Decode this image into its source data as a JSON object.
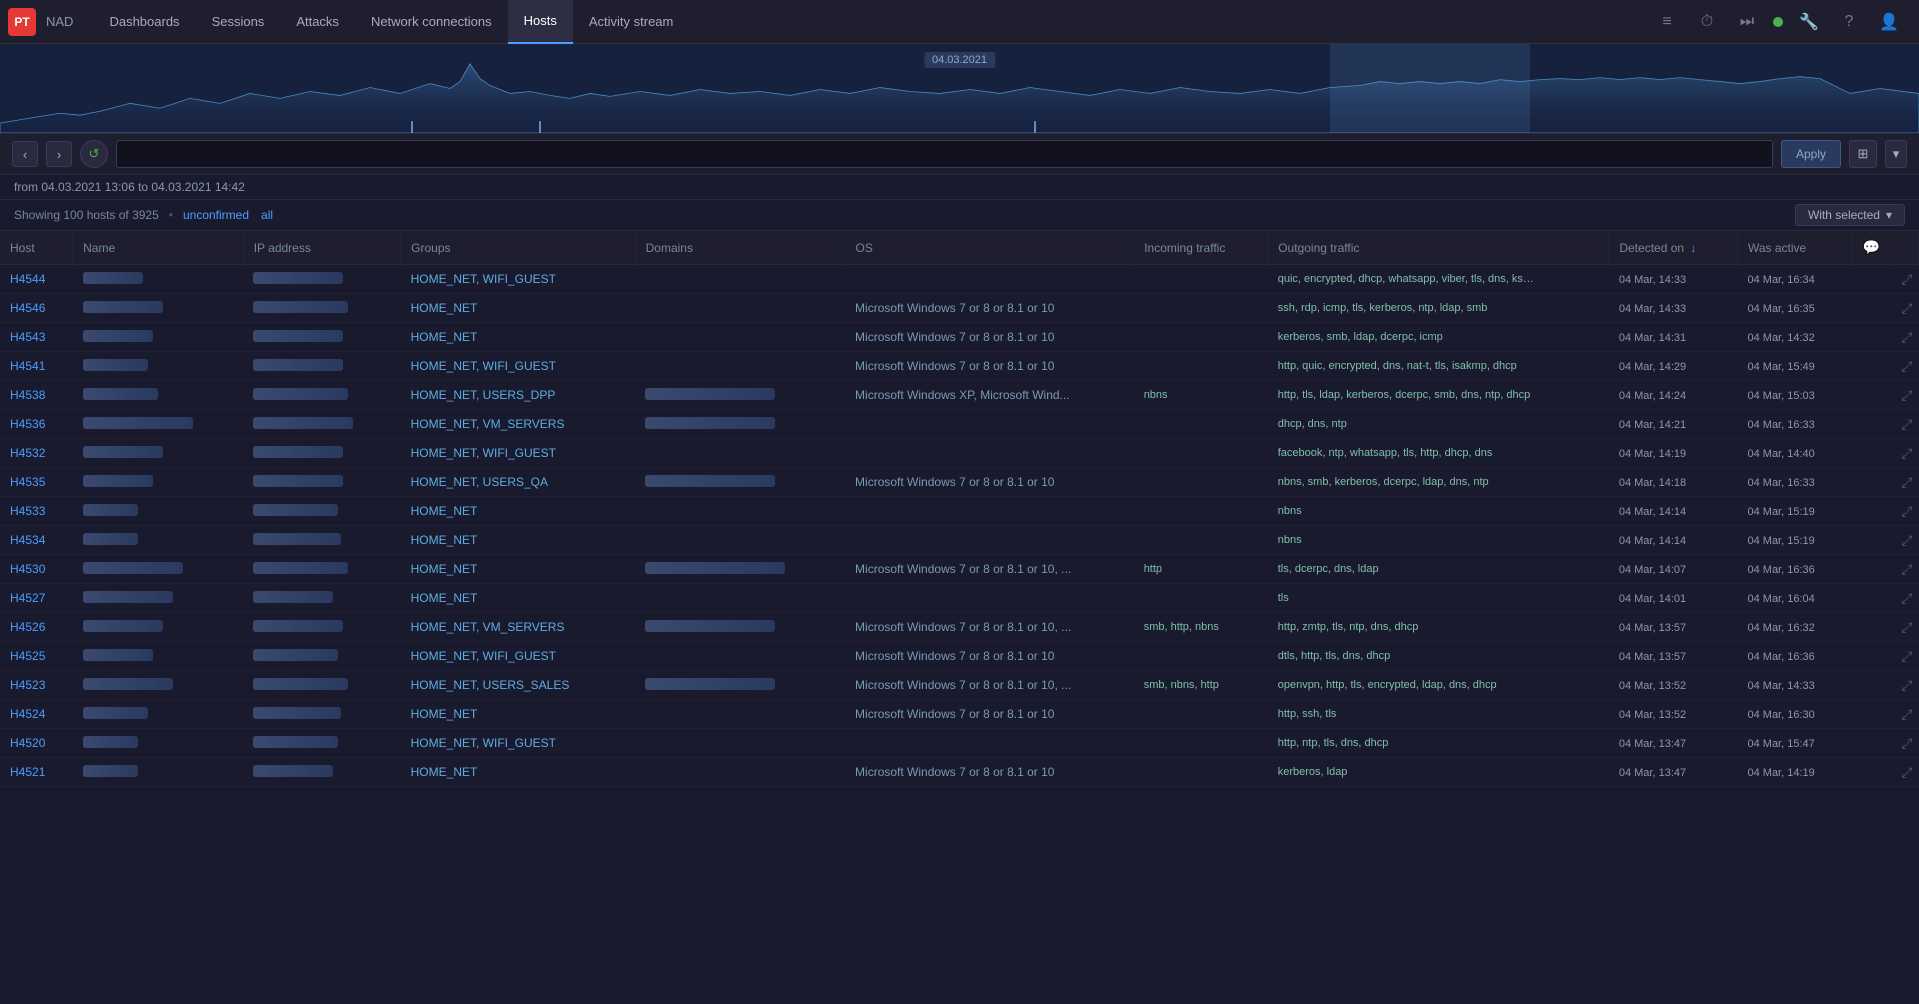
{
  "app": {
    "logo": "PT",
    "name": "NAD"
  },
  "nav": {
    "items": [
      {
        "label": "Dashboards",
        "active": false
      },
      {
        "label": "Sessions",
        "active": false
      },
      {
        "label": "Attacks",
        "active": false
      },
      {
        "label": "Network connections",
        "active": false
      },
      {
        "label": "Hosts",
        "active": true
      },
      {
        "label": "Activity stream",
        "active": false
      }
    ]
  },
  "chart": {
    "date_label": "04.03.2021"
  },
  "filter": {
    "date_range": "from 04.03.2021 13:06 to 04.03.2021 14:42",
    "apply_label": "Apply",
    "input_placeholder": "",
    "input_value": ""
  },
  "status": {
    "showing": "Showing 100 hosts of 3925",
    "unconfirmed": "unconfirmed",
    "all": "all",
    "with_selected": "With selected"
  },
  "table": {
    "columns": [
      "Host",
      "Name",
      "IP address",
      "Groups",
      "Domains",
      "OS",
      "Incoming traffic",
      "Outgoing traffic",
      "Detected on",
      "Was active",
      ""
    ],
    "detected_on_sort": "↓",
    "rows": [
      {
        "id": "H4544",
        "name": "",
        "ip": "",
        "groups": "HOME_NET, WIFI_GUEST",
        "domains": "",
        "os": "",
        "in_traffic": "",
        "out_traffic": "quic, encrypted, dhcp, whatsapp, viber, tls, dns, ksn, http",
        "detected": "04 Mar, 14:33",
        "active": "04 Mar, 16:34"
      },
      {
        "id": "H4546",
        "name": "",
        "ip": "",
        "groups": "HOME_NET",
        "domains": "",
        "os": "Microsoft Windows 7 or 8 or 8.1 or 10",
        "in_traffic": "",
        "out_traffic": "ssh, rdp, icmp, tls, kerberos, ntp, ldap, smb",
        "detected": "04 Mar, 14:33",
        "active": "04 Mar, 16:35"
      },
      {
        "id": "H4543",
        "name": "",
        "ip": "",
        "groups": "HOME_NET",
        "domains": "",
        "os": "Microsoft Windows 7 or 8 or 8.1 or 10",
        "in_traffic": "",
        "out_traffic": "kerberos, smb, ldap, dcerpc, icmp",
        "detected": "04 Mar, 14:31",
        "active": "04 Mar, 14:32"
      },
      {
        "id": "H4541",
        "name": "",
        "ip": "",
        "groups": "HOME_NET, WIFI_GUEST",
        "domains": "",
        "os": "Microsoft Windows 7 or 8 or 8.1 or 10",
        "in_traffic": "",
        "out_traffic": "http, quic, encrypted, dns, nat-t, tls, isakmp, dhcp",
        "detected": "04 Mar, 14:29",
        "active": "04 Mar, 15:49"
      },
      {
        "id": "H4538",
        "name": "",
        "ip": "",
        "groups": "HOME_NET, USERS_DPP",
        "domains": "",
        "os": "Microsoft Windows XP, Microsoft Wind...",
        "in_traffic": "nbns",
        "out_traffic": "http, tls, ldap, kerberos, dcerpc, smb, dns, ntp, dhcp",
        "detected": "04 Mar, 14:24",
        "active": "04 Mar, 15:03"
      },
      {
        "id": "H4536",
        "name": "",
        "ip": "",
        "groups": "HOME_NET, VM_SERVERS",
        "domains": "",
        "os": "",
        "in_traffic": "",
        "out_traffic": "dhcp, dns, ntp",
        "detected": "04 Mar, 14:21",
        "active": "04 Mar, 16:33"
      },
      {
        "id": "H4532",
        "name": "",
        "ip": "",
        "groups": "HOME_NET, WIFI_GUEST",
        "domains": "",
        "os": "",
        "in_traffic": "",
        "out_traffic": "facebook, ntp, whatsapp, tls, http, dhcp, dns",
        "detected": "04 Mar, 14:19",
        "active": "04 Mar, 14:40"
      },
      {
        "id": "H4535",
        "name": "",
        "ip": "",
        "groups": "HOME_NET, USERS_QA",
        "domains": "",
        "os": "Microsoft Windows 7 or 8 or 8.1 or 10",
        "in_traffic": "",
        "out_traffic": "nbns, smb, kerberos, dcerpc, ldap, dns, ntp",
        "detected": "04 Mar, 14:18",
        "active": "04 Mar, 16:33"
      },
      {
        "id": "H4533",
        "name": "",
        "ip": "",
        "groups": "HOME_NET",
        "domains": "",
        "os": "",
        "in_traffic": "",
        "out_traffic": "nbns",
        "detected": "04 Mar, 14:14",
        "active": "04 Mar, 15:19"
      },
      {
        "id": "H4534",
        "name": "",
        "ip": "",
        "groups": "HOME_NET",
        "domains": "",
        "os": "",
        "in_traffic": "",
        "out_traffic": "nbns",
        "detected": "04 Mar, 14:14",
        "active": "04 Mar, 15:19"
      },
      {
        "id": "H4530",
        "name": "",
        "ip": "",
        "groups": "HOME_NET",
        "domains": "",
        "os": "Microsoft Windows 7 or 8 or 8.1 or 10, ...",
        "in_traffic": "http",
        "out_traffic": "tls, dcerpc, dns, ldap",
        "detected": "04 Mar, 14:07",
        "active": "04 Mar, 16:36"
      },
      {
        "id": "H4527",
        "name": "",
        "ip": "",
        "groups": "HOME_NET",
        "domains": "",
        "os": "",
        "in_traffic": "",
        "out_traffic": "tls",
        "detected": "04 Mar, 14:01",
        "active": "04 Mar, 16:04"
      },
      {
        "id": "H4526",
        "name": "",
        "ip": "",
        "groups": "HOME_NET, VM_SERVERS",
        "domains": "",
        "os": "Microsoft Windows 7 or 8 or 8.1 or 10, ...",
        "in_traffic": "smb, http, nbns",
        "out_traffic": "http, zmtp, tls, ntp, dns, dhcp",
        "detected": "04 Mar, 13:57",
        "active": "04 Mar, 16:32"
      },
      {
        "id": "H4525",
        "name": "",
        "ip": "",
        "groups": "HOME_NET, WIFI_GUEST",
        "domains": "",
        "os": "Microsoft Windows 7 or 8 or 8.1 or 10",
        "in_traffic": "",
        "out_traffic": "dtls, http, tls, dns, dhcp",
        "detected": "04 Mar, 13:57",
        "active": "04 Mar, 16:36"
      },
      {
        "id": "H4523",
        "name": "",
        "ip": "",
        "groups": "HOME_NET, USERS_SALES",
        "domains": "",
        "os": "Microsoft Windows 7 or 8 or 8.1 or 10, ...",
        "in_traffic": "smb, nbns, http",
        "out_traffic": "openvpn, http, tls, encrypted, ldap, dns, dhcp",
        "detected": "04 Mar, 13:52",
        "active": "04 Mar, 14:33"
      },
      {
        "id": "H4524",
        "name": "",
        "ip": "",
        "groups": "HOME_NET",
        "domains": "",
        "os": "Microsoft Windows 7 or 8 or 8.1 or 10",
        "in_traffic": "",
        "out_traffic": "http, ssh, tls",
        "detected": "04 Mar, 13:52",
        "active": "04 Mar, 16:30"
      },
      {
        "id": "H4520",
        "name": "",
        "ip": "",
        "groups": "HOME_NET, WIFI_GUEST",
        "domains": "",
        "os": "",
        "in_traffic": "",
        "out_traffic": "http, ntp, tls, dns, dhcp",
        "detected": "04 Mar, 13:47",
        "active": "04 Mar, 15:47"
      },
      {
        "id": "H4521",
        "name": "",
        "ip": "",
        "groups": "HOME_NET",
        "domains": "",
        "os": "Microsoft Windows 7 or 8 or 8.1 or 10",
        "in_traffic": "",
        "out_traffic": "kerberos, ldap",
        "detected": "04 Mar, 13:47",
        "active": "04 Mar, 14:19"
      }
    ]
  }
}
